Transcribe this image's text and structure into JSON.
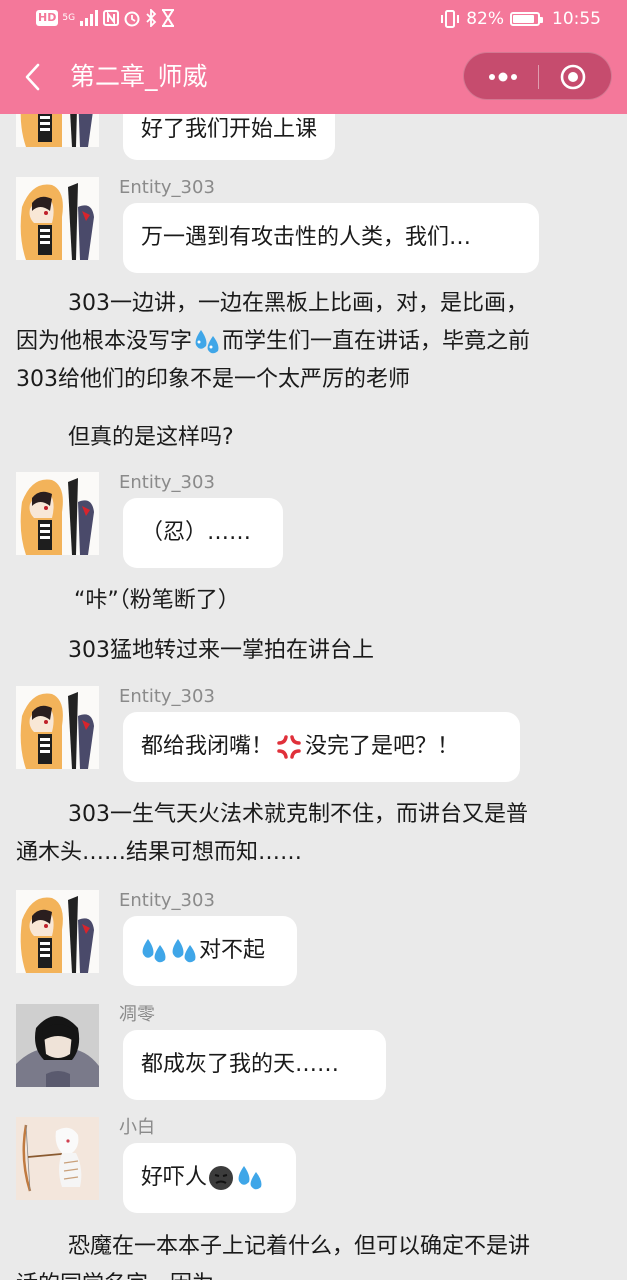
{
  "status_bar": {
    "hd": "HD",
    "signal": "5G",
    "battery": "82%",
    "battery_level": 0.82,
    "time": "10:55"
  },
  "nav": {
    "title": "第二章_师威"
  },
  "messages": {
    "m0": {
      "text": "好了我们开始上课"
    },
    "m1": {
      "speaker": "Entity_303",
      "text": "万一遇到有攻击性的人类，我们…"
    },
    "n1": {
      "a": "303一边讲，一边在黑板上比画，对，是比画，",
      "b": "因为他根本没写字",
      "c": "而学生们一直在讲话，毕竟之前",
      "d": "303给他们的印象不是一个太严厉的老师"
    },
    "n2": "但真的是这样吗?",
    "m2": {
      "speaker": "Entity_303",
      "text": "（忍）……"
    },
    "n3": "“咔”（粉笔断了）",
    "n4": "303猛地转过来一掌拍在讲台上",
    "m3": {
      "speaker": "Entity_303",
      "text_a": "都给我闭嘴！",
      "text_b": "没完了是吧？！"
    },
    "n5": {
      "a": "303一生气天火法术就克制不住，而讲台又是普",
      "b": "通木头……结果可想而知……"
    },
    "m4": {
      "speaker": "Entity_303",
      "text": "对不起"
    },
    "m5": {
      "speaker": "凋零",
      "text": "都成灰了我的天……"
    },
    "m6": {
      "speaker": "小白",
      "text": "好吓人"
    },
    "n6": {
      "a": "恐魔在一本本子上记着什么，但可以确定不是讲",
      "b": "话的同学名字，因为"
    }
  },
  "icons": {
    "back": "chevron-left-icon",
    "more": "more-dots-icon",
    "close": "target-close-icon",
    "sweat": "sweat-droplets-emoji",
    "anger": "anger-symbol-emoji",
    "face": "dark-face-emoji"
  },
  "colors": {
    "header": "#f4789a",
    "background": "#eaeaea",
    "bubble": "#ffffff"
  }
}
